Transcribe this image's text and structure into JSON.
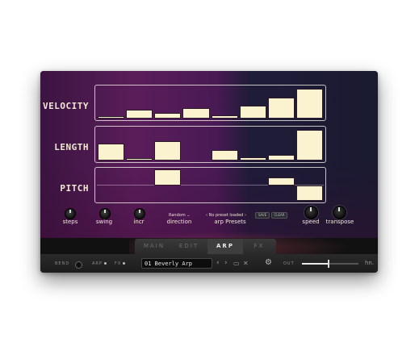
{
  "rows": {
    "velocity_label": "VELOCITY",
    "length_label": "LENGTH",
    "pitch_label": "PITCH"
  },
  "velocity_steps": [
    0.08,
    0.3,
    0.2,
    0.36,
    0.12,
    0.42,
    0.7,
    1.0
  ],
  "length_steps": [
    0.55,
    0.08,
    0.62,
    0.0,
    0.35,
    0.1,
    0.18,
    1.0
  ],
  "pitch_steps": [
    0,
    0,
    1,
    0,
    0,
    0,
    0.5,
    -1
  ],
  "controls": {
    "steps": "steps",
    "swing": "swing",
    "incr": "incr",
    "direction": "direction",
    "direction_value": "Random",
    "arp_presets": "arp Presets",
    "preset_nav": "No preset loaded",
    "save": "SAVE",
    "clear": "CLEAR",
    "speed": "speed",
    "transpose": "transpose"
  },
  "tabs": [
    "MAIN",
    "EDIT",
    "ARP",
    "FX"
  ],
  "active_tab": "ARP",
  "bottom": {
    "bend": "BEND",
    "arp": "ARP",
    "fx": "FX",
    "preset_name": "01 Beverly Arp",
    "out": "OUT",
    "logo": "hn."
  },
  "out_level": 0.45,
  "colors": {
    "bar": "#fbf3cf",
    "accent": "#e8e8e8"
  }
}
